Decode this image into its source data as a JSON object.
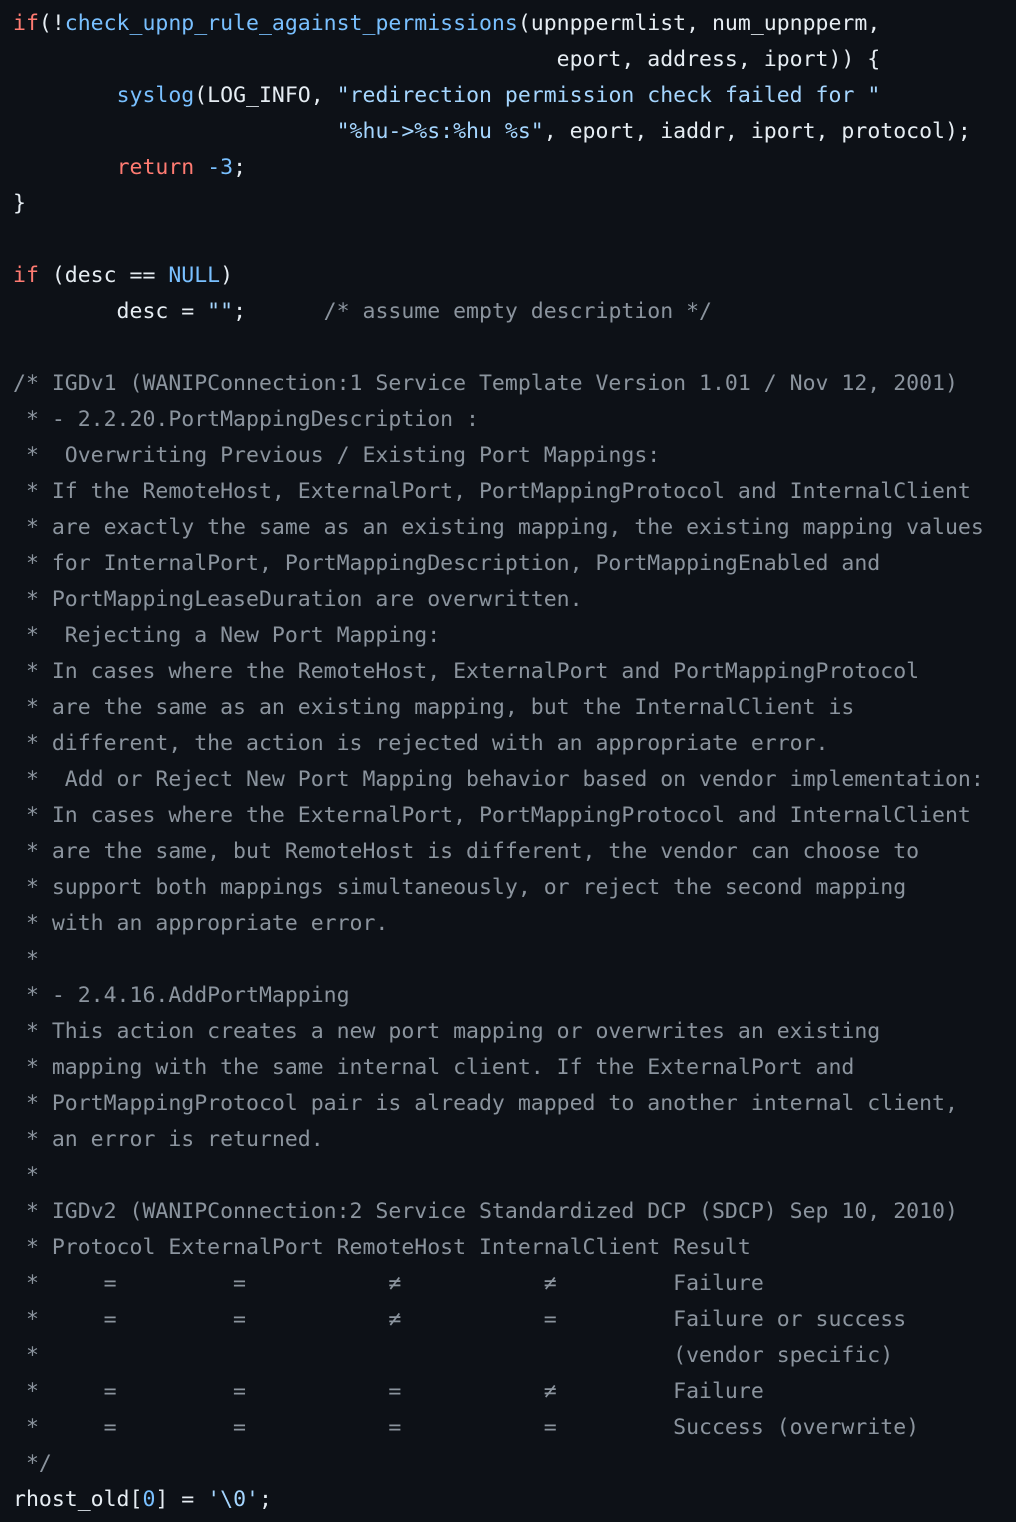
{
  "code": {
    "lines": [
      [
        {
          "t": "if",
          "c": "kw"
        },
        {
          "t": "(!",
          "c": "plain"
        },
        {
          "t": "check_upnp_rule_against_permissions",
          "c": "call"
        },
        {
          "t": "(upnppermlist, num_upnpperm,",
          "c": "plain"
        }
      ],
      [
        {
          "t": "                                          eport, address, iport)) {",
          "c": "plain"
        }
      ],
      [
        {
          "t": "        ",
          "c": "plain"
        },
        {
          "t": "syslog",
          "c": "call"
        },
        {
          "t": "(LOG_INFO, ",
          "c": "plain"
        },
        {
          "t": "\"redirection permission check failed for \"",
          "c": "str"
        }
      ],
      [
        {
          "t": "                         ",
          "c": "plain"
        },
        {
          "t": "\"%hu->%s:%hu %s\"",
          "c": "str"
        },
        {
          "t": ", eport, iaddr, iport, protocol);",
          "c": "plain"
        }
      ],
      [
        {
          "t": "        ",
          "c": "plain"
        },
        {
          "t": "return",
          "c": "kw"
        },
        {
          "t": " ",
          "c": "plain"
        },
        {
          "t": "-3",
          "c": "num"
        },
        {
          "t": ";",
          "c": "plain"
        }
      ],
      [
        {
          "t": "}",
          "c": "plain"
        }
      ],
      [
        {
          "t": "",
          "c": "plain"
        }
      ],
      [
        {
          "t": "if",
          "c": "kw"
        },
        {
          "t": " (desc == ",
          "c": "plain"
        },
        {
          "t": "NULL",
          "c": "num"
        },
        {
          "t": ")",
          "c": "plain"
        }
      ],
      [
        {
          "t": "        desc = ",
          "c": "plain"
        },
        {
          "t": "\"\"",
          "c": "str"
        },
        {
          "t": ";      ",
          "c": "plain"
        },
        {
          "t": "/* assume empty description */",
          "c": "cmt"
        }
      ],
      [
        {
          "t": "",
          "c": "plain"
        }
      ],
      [
        {
          "t": "/* IGDv1 (WANIPConnection:1 Service Template Version 1.01 / Nov 12, 2001)",
          "c": "cmt"
        }
      ],
      [
        {
          "t": " * - 2.2.20.PortMappingDescription :",
          "c": "cmt"
        }
      ],
      [
        {
          "t": " *  Overwriting Previous / Existing Port Mappings:",
          "c": "cmt"
        }
      ],
      [
        {
          "t": " * If the RemoteHost, ExternalPort, PortMappingProtocol and InternalClient",
          "c": "cmt"
        }
      ],
      [
        {
          "t": " * are exactly the same as an existing mapping, the existing mapping values",
          "c": "cmt"
        }
      ],
      [
        {
          "t": " * for InternalPort, PortMappingDescription, PortMappingEnabled and",
          "c": "cmt"
        }
      ],
      [
        {
          "t": " * PortMappingLeaseDuration are overwritten.",
          "c": "cmt"
        }
      ],
      [
        {
          "t": " *  Rejecting a New Port Mapping:",
          "c": "cmt"
        }
      ],
      [
        {
          "t": " * In cases where the RemoteHost, ExternalPort and PortMappingProtocol",
          "c": "cmt"
        }
      ],
      [
        {
          "t": " * are the same as an existing mapping, but the InternalClient is",
          "c": "cmt"
        }
      ],
      [
        {
          "t": " * different, the action is rejected with an appropriate error.",
          "c": "cmt"
        }
      ],
      [
        {
          "t": " *  Add or Reject New Port Mapping behavior based on vendor implementation:",
          "c": "cmt"
        }
      ],
      [
        {
          "t": " * In cases where the ExternalPort, PortMappingProtocol and InternalClient",
          "c": "cmt"
        }
      ],
      [
        {
          "t": " * are the same, but RemoteHost is different, the vendor can choose to",
          "c": "cmt"
        }
      ],
      [
        {
          "t": " * support both mappings simultaneously, or reject the second mapping",
          "c": "cmt"
        }
      ],
      [
        {
          "t": " * with an appropriate error.",
          "c": "cmt"
        }
      ],
      [
        {
          "t": " *",
          "c": "cmt"
        }
      ],
      [
        {
          "t": " * - 2.4.16.AddPortMapping",
          "c": "cmt"
        }
      ],
      [
        {
          "t": " * This action creates a new port mapping or overwrites an existing",
          "c": "cmt"
        }
      ],
      [
        {
          "t": " * mapping with the same internal client. If the ExternalPort and",
          "c": "cmt"
        }
      ],
      [
        {
          "t": " * PortMappingProtocol pair is already mapped to another internal client,",
          "c": "cmt"
        }
      ],
      [
        {
          "t": " * an error is returned.",
          "c": "cmt"
        }
      ],
      [
        {
          "t": " *",
          "c": "cmt"
        }
      ],
      [
        {
          "t": " * IGDv2 (WANIPConnection:2 Service Standardized DCP (SDCP) Sep 10, 2010)",
          "c": "cmt"
        }
      ],
      [
        {
          "t": " * Protocol ExternalPort RemoteHost InternalClient Result",
          "c": "cmt"
        }
      ],
      [
        {
          "t": " *     =         =           ≠           ≠         Failure",
          "c": "cmt"
        }
      ],
      [
        {
          "t": " *     =         =           ≠           =         Failure or success",
          "c": "cmt"
        }
      ],
      [
        {
          "t": " *                                                 (vendor specific)",
          "c": "cmt"
        }
      ],
      [
        {
          "t": " *     =         =           =           ≠         Failure",
          "c": "cmt"
        }
      ],
      [
        {
          "t": " *     =         =           =           =         Success (overwrite)",
          "c": "cmt"
        }
      ],
      [
        {
          "t": " */",
          "c": "cmt"
        }
      ],
      [
        {
          "t": "rhost_old[",
          "c": "plain"
        },
        {
          "t": "0",
          "c": "num"
        },
        {
          "t": "] = ",
          "c": "plain"
        },
        {
          "t": "'\\0'",
          "c": "str"
        },
        {
          "t": ";",
          "c": "plain"
        }
      ]
    ]
  }
}
